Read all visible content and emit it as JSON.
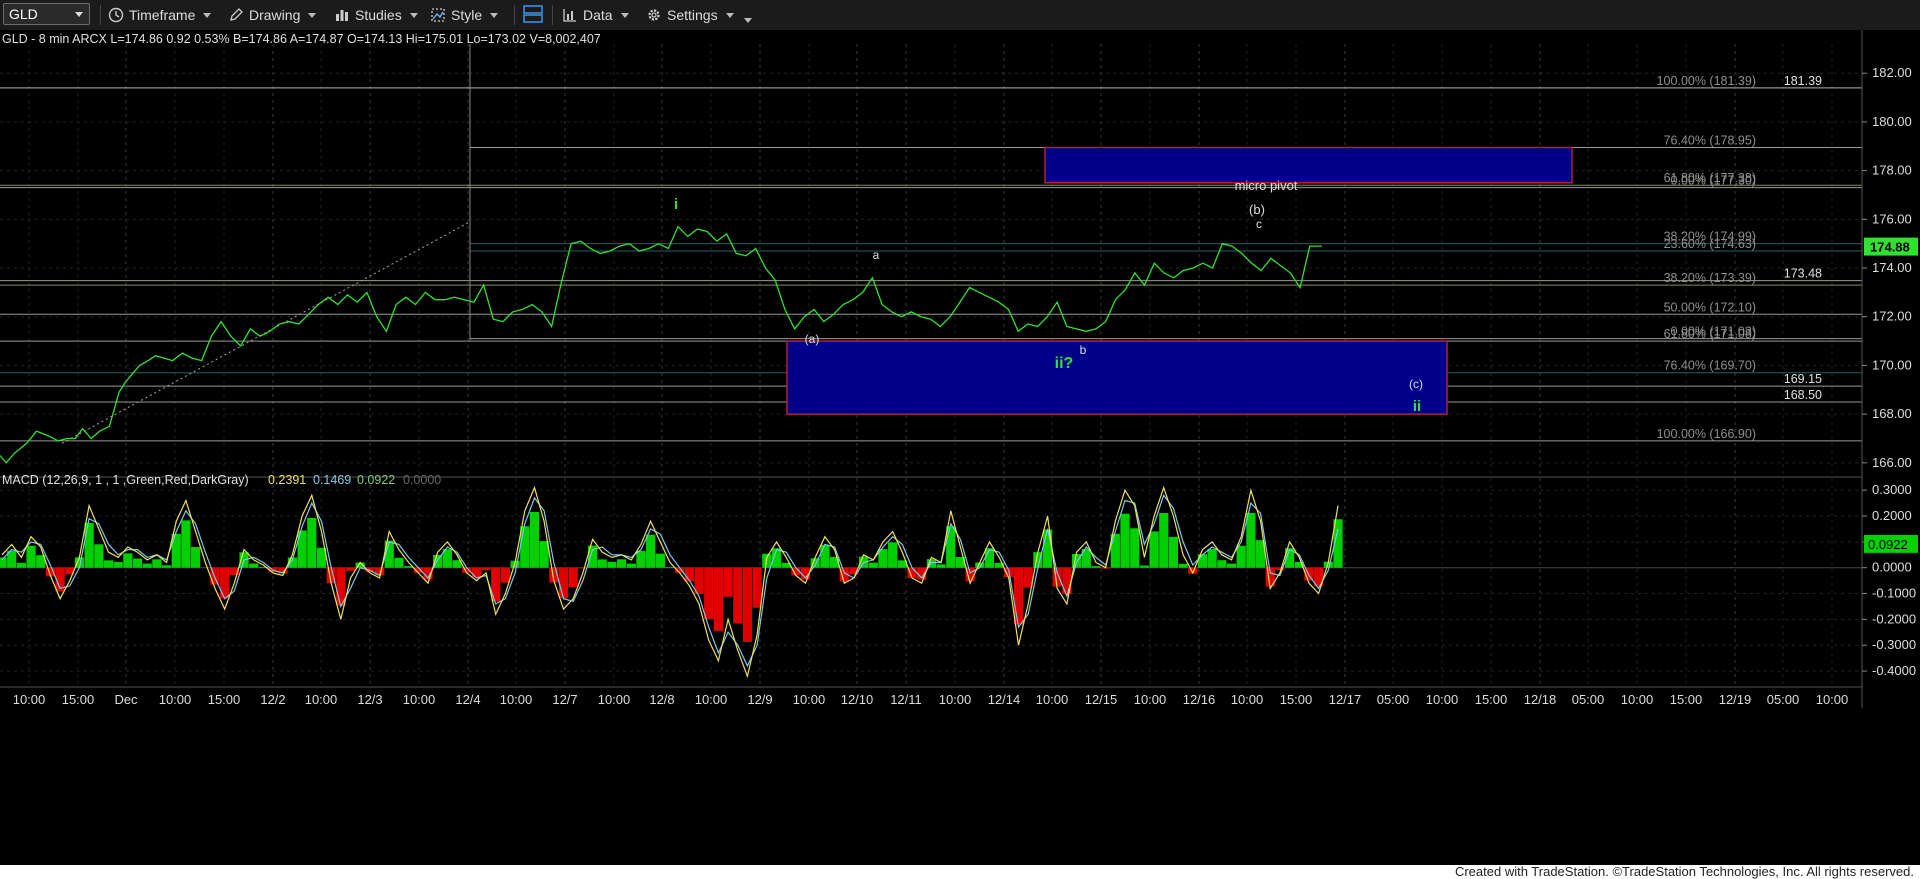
{
  "toolbar": {
    "symbol": "GLD",
    "timeframe_label": "Timeframe",
    "drawing_label": "Drawing",
    "studies_label": "Studies",
    "style_label": "Style",
    "data_label": "Data",
    "settings_label": "Settings"
  },
  "header_text": {
    "quote_line": "GLD - 8 min  ARCX  L=174.86  0.92   0.53%  B=174.86  A=174.87  O=174.13  Hi=175.01  Lo=173.02  V=8,002,407",
    "macd_label": "MACD (12,26,9, 1 , 1 ,Green,Red,DarkGray)",
    "macd_values": [
      "0.2391",
      "0.1469",
      "0.0922",
      "0.0000"
    ]
  },
  "footer": {
    "credit": "Created with TradeStation. ©TradeStation Technologies, Inc. All rights reserved."
  },
  "colors": {
    "price": "#32e032",
    "fib_label": "#8f8f8f",
    "box_fill": "#00008b",
    "box_border": "#b0203a",
    "macd_pos": "#00d000",
    "macd_neg": "#e00000",
    "macd_line": "#f0e060",
    "signal_line": "#80c8e8",
    "wave_green": "#32e032"
  },
  "chart_data": [
    {
      "type": "line",
      "title": "GLD - 8 min",
      "ylim": [
        165.5,
        183.2
      ],
      "y_ticks": [
        "182.00",
        "180.00",
        "178.00",
        "176.00",
        "174.00",
        "172.00",
        "170.00",
        "168.00",
        "166.00"
      ],
      "y_tick_values": [
        182,
        180,
        178,
        176,
        174,
        172,
        170,
        168,
        166
      ],
      "x_tick_labels": [
        "10:00",
        "15:00",
        "Dec",
        "10:00",
        "15:00",
        "12/2",
        "10:00",
        "12/3",
        "10:00",
        "12/4",
        "10:00",
        "12/7",
        "10:00",
        "12/8",
        "10:00",
        "12/9",
        "10:00",
        "12/10",
        "12/11",
        "10:00",
        "12/14",
        "10:00",
        "12/15",
        "10:00",
        "12/16",
        "10:00",
        "15:00",
        "12/17",
        "05:00",
        "10:00",
        "15:00",
        "12/18",
        "05:00",
        "10:00",
        "15:00",
        "12/19",
        "05:00",
        "10:00"
      ],
      "series": [
        {
          "name": "GLD",
          "x": [
            0,
            5,
            12,
            22,
            30,
            40,
            48,
            55,
            62,
            68,
            75,
            82,
            90,
            98,
            103,
            108,
            115,
            122,
            128,
            135,
            142,
            150,
            158,
            166,
            174,
            182,
            190,
            198,
            206,
            214,
            222,
            230,
            238,
            246,
            254,
            262,
            270,
            278,
            286,
            294,
            302,
            310,
            318,
            326,
            334,
            342,
            350,
            358,
            366,
            374,
            382,
            390,
            398,
            406,
            414,
            422,
            430,
            438,
            446,
            454,
            462,
            470,
            478,
            486,
            494,
            502,
            510,
            518,
            526,
            534,
            542,
            550,
            558,
            566,
            574,
            582,
            590,
            598,
            606,
            614,
            622,
            630,
            638,
            646,
            654,
            662,
            670,
            678,
            686,
            694,
            702,
            710,
            718,
            726,
            734,
            742,
            750,
            758,
            766,
            774,
            782,
            790,
            798,
            806,
            814,
            822,
            830,
            838,
            846,
            854,
            862,
            870,
            878,
            886,
            894,
            902,
            910,
            918,
            926,
            934,
            942,
            950,
            958,
            966,
            974,
            982,
            990,
            998,
            1006,
            1014,
            1022,
            1030,
            1038,
            1046,
            1054,
            1062,
            1070,
            1078,
            1088
          ],
          "values": [
            166.3,
            166.0,
            166.4,
            166.8,
            167.3,
            167.1,
            166.9,
            167.0,
            167.0,
            167.4,
            167.0,
            167.3,
            167.5,
            168.9,
            169.3,
            169.6,
            170.0,
            170.2,
            170.4,
            170.3,
            170.2,
            170.5,
            170.3,
            170.2,
            171.2,
            171.8,
            171.2,
            170.8,
            171.5,
            171.2,
            171.4,
            171.7,
            171.8,
            171.7,
            172.1,
            172.5,
            172.8,
            172.5,
            172.9,
            172.6,
            173.0,
            172.0,
            171.4,
            172.5,
            172.8,
            172.5,
            173.0,
            172.7,
            172.7,
            172.8,
            172.7,
            172.6,
            173.3,
            171.9,
            171.8,
            172.2,
            172.3,
            172.5,
            172.2,
            171.6,
            173.4,
            175.0,
            175.1,
            174.8,
            174.6,
            174.7,
            174.9,
            175.0,
            174.7,
            174.8,
            175.0,
            174.8,
            175.7,
            175.3,
            175.6,
            175.5,
            175.1,
            175.4,
            174.6,
            174.5,
            174.8,
            174.0,
            173.5,
            172.3,
            171.5,
            172.0,
            172.3,
            171.8,
            172.1,
            172.5,
            172.7,
            173.0,
            173.6,
            172.5,
            172.2,
            172.0,
            172.2,
            172.0,
            171.9,
            171.6,
            172.0,
            172.6,
            173.2,
            173.0,
            172.8,
            172.6,
            172.3,
            171.4,
            171.7,
            171.6,
            172.0,
            172.6,
            171.6,
            171.5,
            171.4,
            171.5,
            171.8,
            172.7,
            173.1,
            173.8,
            173.3,
            174.2,
            173.8,
            173.6,
            173.9,
            174.0,
            174.2,
            174.0,
            175.0,
            174.9,
            174.6,
            174.2,
            173.9,
            174.4,
            174.1,
            173.8,
            173.2,
            174.9,
            174.9
          ]
        }
      ],
      "fib_labels": [
        {
          "text": "100.00% (181.39)",
          "value": 181.4
        },
        {
          "text": "181.39",
          "value": 181.4
        },
        {
          "text": "76.40% (178.95)",
          "value": 178.95
        },
        {
          "text": "61.80% (177.38)",
          "value": 177.4
        },
        {
          "text": "0.00% (177.30)",
          "value": 177.3
        },
        {
          "text": "38.20% (174.99)",
          "value": 175.0
        },
        {
          "text": "23.60% (174.63)",
          "value": 174.7
        },
        {
          "text": "38.20% (173.39)",
          "value": 173.3
        },
        {
          "text": "173.48",
          "value": 173.48
        },
        {
          "text": "50.00% (172.10)",
          "value": 172.1
        },
        {
          "text": "61.80% (171.08)",
          "value": 171.0
        },
        {
          "text": "0.00% (171.03)",
          "value": 171.1
        },
        {
          "text": "76.40% (169.70)",
          "value": 169.7
        },
        {
          "text": "169.15",
          "value": 169.15
        },
        {
          "text": "168.50",
          "value": 168.5
        },
        {
          "text": "100.00% (166.90)",
          "value": 166.9
        }
      ],
      "current_price_label": "174.88",
      "annotations": [
        {
          "text": "micro pivot"
        },
        {
          "text": "i"
        },
        {
          "text": "a"
        },
        {
          "text": "(a)"
        },
        {
          "text": "b"
        },
        {
          "text": "ii?"
        },
        {
          "text": "(b)"
        },
        {
          "text": "c"
        },
        {
          "text": "(c)"
        },
        {
          "text": "ii"
        }
      ]
    },
    {
      "type": "bar",
      "title": "MACD (12,26,9, 1 , 1 ,Green,Red,DarkGray)",
      "ylim": [
        -0.45,
        0.32
      ],
      "y_ticks": [
        "0.3000",
        "0.2000",
        "0.1000",
        "0.0000",
        "-0.1000",
        "-0.2000",
        "-0.3000",
        "-0.4000"
      ],
      "y_tick_values": [
        0.3,
        0.2,
        0.1,
        0.0,
        -0.1,
        -0.2,
        -0.3,
        -0.4
      ],
      "current_value_label": "0.0922",
      "series": [
        {
          "name": "MACD",
          "values": [
            0.05,
            0.09,
            0.04,
            0.12,
            0.08,
            -0.03,
            -0.12,
            -0.05,
            0.04,
            0.24,
            0.15,
            0.06,
            0.04,
            0.08,
            0.06,
            0.03,
            0.05,
            0.02,
            0.18,
            0.26,
            0.14,
            0.02,
            -0.08,
            -0.16,
            -0.06,
            0.07,
            0.03,
            0.01,
            -0.02,
            -0.03,
            0.05,
            0.2,
            0.28,
            0.14,
            -0.06,
            -0.2,
            -0.04,
            0.02,
            -0.02,
            -0.04,
            0.14,
            0.07,
            0.02,
            -0.02,
            -0.06,
            0.06,
            0.1,
            0.05,
            -0.02,
            -0.05,
            -0.02,
            -0.18,
            -0.1,
            0.02,
            0.22,
            0.31,
            0.18,
            -0.05,
            -0.16,
            -0.12,
            -0.02,
            0.11,
            0.06,
            0.04,
            0.05,
            0.03,
            0.09,
            0.18,
            0.1,
            0.02,
            -0.02,
            -0.07,
            -0.14,
            -0.28,
            -0.36,
            -0.2,
            -0.32,
            -0.42,
            -0.26,
            0.04,
            0.1,
            0.04,
            -0.03,
            -0.06,
            0.04,
            0.12,
            0.07,
            -0.06,
            -0.04,
            0.05,
            0.03,
            0.1,
            0.14,
            0.06,
            -0.04,
            -0.06,
            0.04,
            0.02,
            0.22,
            0.08,
            -0.06,
            0.02,
            0.1,
            0.04,
            -0.04,
            -0.3,
            -0.14,
            0.06,
            0.2,
            -0.08,
            -0.14,
            0.06,
            0.1,
            0.02,
            0.0,
            0.18,
            0.3,
            0.24,
            0.04,
            0.2,
            0.31,
            0.2,
            0.05,
            -0.02,
            0.07,
            0.1,
            0.05,
            0.03,
            0.12,
            0.3,
            0.18,
            -0.08,
            -0.02,
            0.1,
            0.04,
            -0.06,
            -0.1,
            0.02,
            0.24
          ]
        },
        {
          "name": "Signal",
          "values": [
            0.03,
            0.07,
            0.06,
            0.1,
            0.09,
            0.01,
            -0.08,
            -0.07,
            0.0,
            0.19,
            0.17,
            0.09,
            0.05,
            0.07,
            0.07,
            0.04,
            0.05,
            0.03,
            0.14,
            0.22,
            0.17,
            0.06,
            -0.04,
            -0.12,
            -0.09,
            0.03,
            0.04,
            0.02,
            -0.01,
            -0.02,
            0.03,
            0.16,
            0.25,
            0.18,
            0.0,
            -0.15,
            -0.08,
            0.0,
            -0.01,
            -0.03,
            0.1,
            0.09,
            0.04,
            0.0,
            -0.04,
            0.03,
            0.08,
            0.06,
            0.0,
            -0.04,
            -0.03,
            -0.14,
            -0.12,
            -0.02,
            0.17,
            0.27,
            0.22,
            0.02,
            -0.12,
            -0.13,
            -0.05,
            0.07,
            0.08,
            0.05,
            0.05,
            0.04,
            0.07,
            0.15,
            0.13,
            0.05,
            0.0,
            -0.05,
            -0.11,
            -0.23,
            -0.33,
            -0.25,
            -0.3,
            -0.38,
            -0.3,
            -0.04,
            0.07,
            0.06,
            0.0,
            -0.04,
            0.01,
            0.09,
            0.08,
            -0.02,
            -0.04,
            0.02,
            0.03,
            0.08,
            0.12,
            0.09,
            0.0,
            -0.04,
            0.02,
            0.02,
            0.17,
            0.11,
            -0.02,
            0.0,
            0.07,
            0.06,
            -0.01,
            -0.23,
            -0.18,
            0.0,
            0.15,
            -0.02,
            -0.11,
            0.02,
            0.08,
            0.04,
            0.01,
            0.14,
            0.26,
            0.25,
            0.09,
            0.17,
            0.28,
            0.23,
            0.1,
            0.01,
            0.05,
            0.08,
            0.06,
            0.04,
            0.1,
            0.25,
            0.21,
            -0.02,
            -0.03,
            0.07,
            0.05,
            -0.03,
            -0.08,
            -0.01,
            0.15
          ]
        }
      ]
    }
  ]
}
